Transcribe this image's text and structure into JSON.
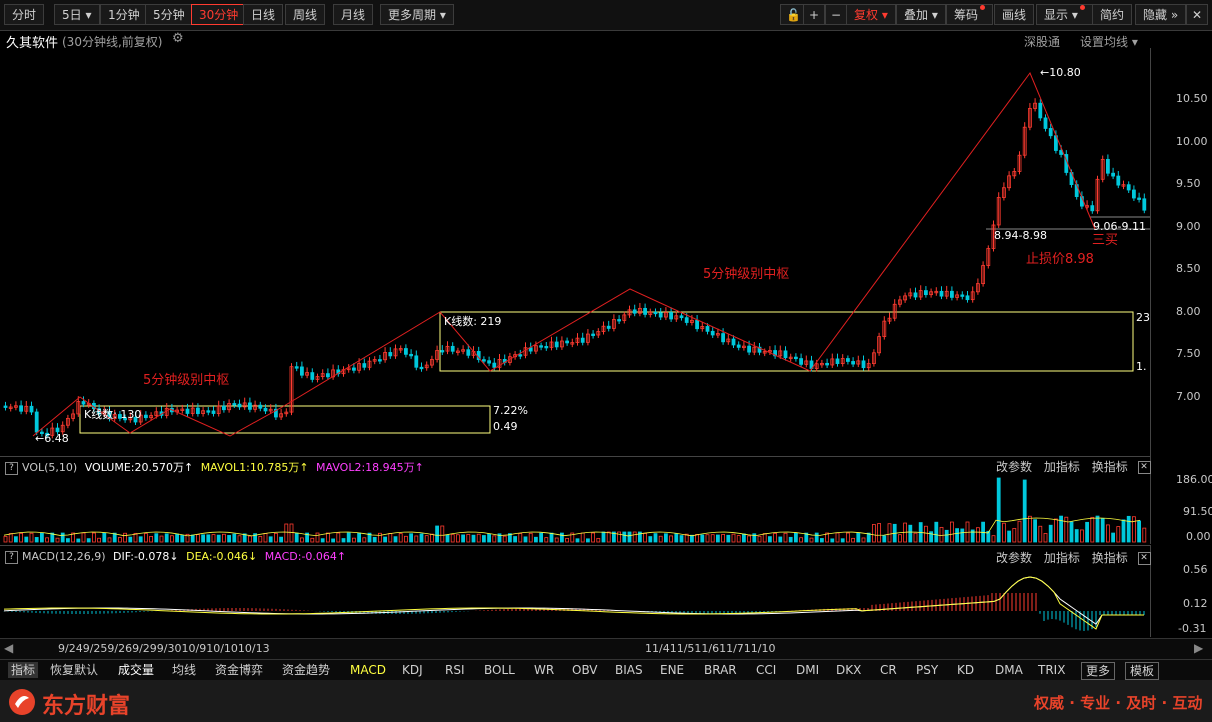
{
  "toolbar": {
    "left": [
      "分时",
      "5日",
      "1分钟",
      "5分钟",
      "30分钟",
      "日线",
      "周线",
      "月线",
      "更多周期"
    ],
    "right": [
      "复权",
      "叠加",
      "筹码",
      "画线",
      "显示",
      "简约",
      "隐藏"
    ]
  },
  "title": {
    "stock": "久其软件",
    "period": "(30分钟线,前复权)",
    "right1": "深股通",
    "right2": "设置均线"
  },
  "price_axis": [
    "10.50",
    "10.00",
    "9.50",
    "9.00",
    "8.50",
    "8.00",
    "7.50",
    "7.00"
  ],
  "annotations": {
    "high": "10.80",
    "low": "6.48",
    "box1_count": "K线数: 130",
    "box1_pct": "7.22%",
    "box1_amt": "0.49",
    "box1_label": "5分钟级别中枢",
    "box2_count": "K线数: 219",
    "box2_label": "5分钟级别中枢",
    "box2_r1": "23",
    "box2_r2": "1.",
    "range1": "8.94-8.98",
    "range2": "9.06-9.11",
    "stop": "止损价8.98",
    "buy3": "三买"
  },
  "vol": {
    "name": "VOL(5,10)",
    "volume": "VOLUME:20.570万",
    "mavol1": "MAVOL1:10.785万",
    "mavol2": "MAVOL2:18.945万",
    "axis": [
      "186.00",
      "91.50",
      "0.00"
    ],
    "btns": [
      "改参数",
      "加指标",
      "换指标"
    ]
  },
  "macd": {
    "name": "MACD(12,26,9)",
    "dif": "DIF:-0.078",
    "dea": "DEA:-0.046",
    "macd": "MACD:-0.064",
    "axis": [
      "0.56",
      "0.12",
      "-0.31"
    ],
    "btns": [
      "改参数",
      "加指标",
      "换指标"
    ]
  },
  "dates": {
    "left": "9/249/259/269/299/3010/910/1010/13",
    "mid": "11/411/511/611/711/10"
  },
  "tabs": [
    "指标",
    "恢复默认",
    "成交量",
    "均线",
    "资金博弈",
    "资金趋势",
    "MACD",
    "KDJ",
    "RSI",
    "BOLL",
    "WR",
    "OBV",
    "BIAS",
    "ENE",
    "BRAR",
    "CCI",
    "DMI",
    "DKX",
    "CR",
    "PSY",
    "KD",
    "DMA",
    "TRIX",
    "更多",
    "模板"
  ],
  "footer": {
    "brand": "东方财富",
    "slogan": "权威 · 专业 · 及时 · 互动"
  },
  "colors": {
    "up": "#ff3b30",
    "down": "#00c8dc",
    "box": "#ffff80",
    "mavol2": "#ff40ff",
    "dea": "#ffff40"
  }
}
